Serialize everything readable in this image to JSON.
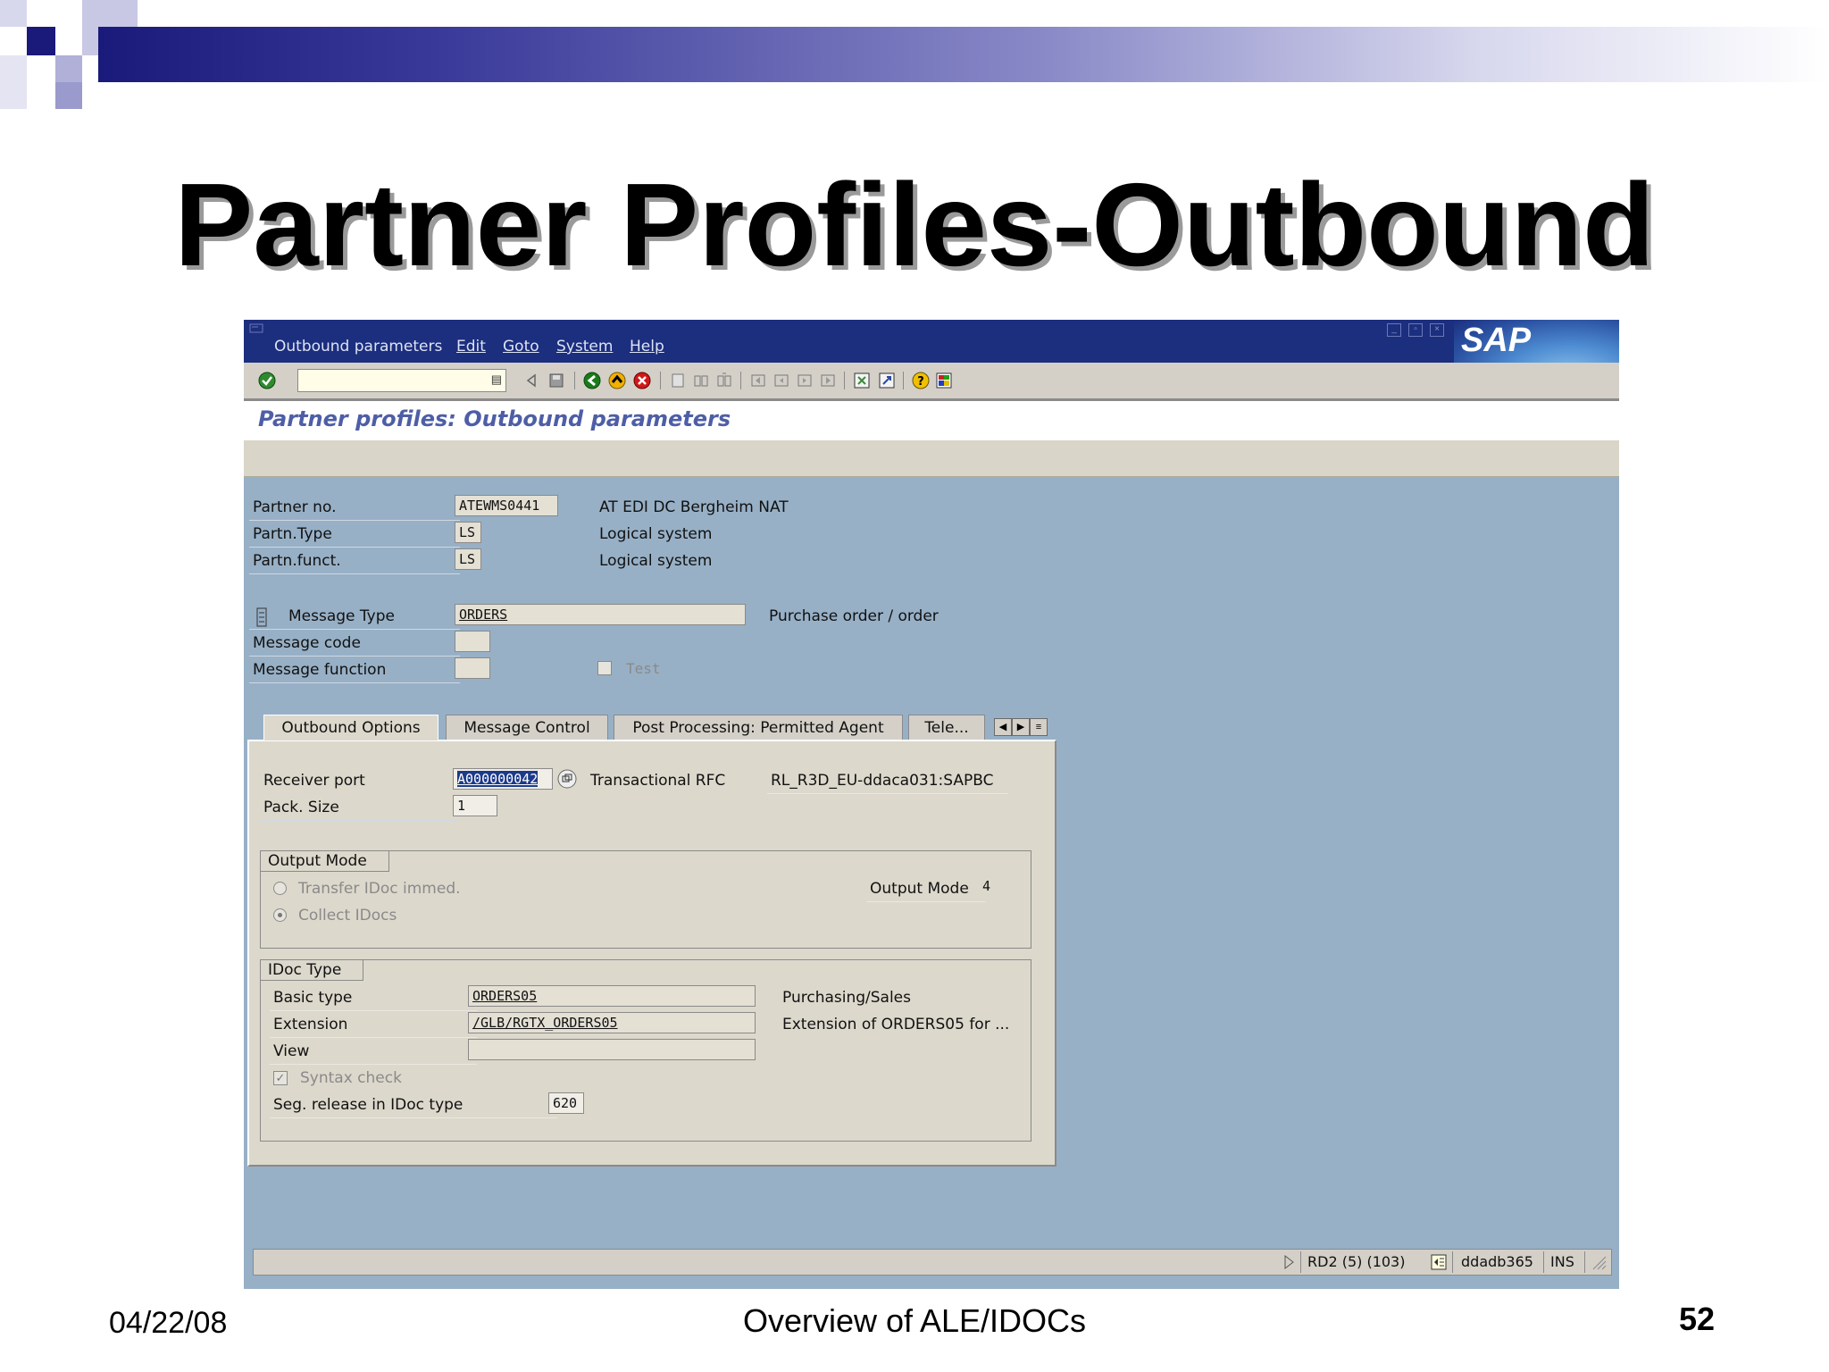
{
  "slide": {
    "title": "Partner Profiles-Outbound",
    "date": "04/22/08",
    "footer_center": "Overview of ALE/IDOCs",
    "page_number": "52"
  },
  "window": {
    "menu": [
      "Outbound parameters",
      "Edit",
      "Goto",
      "System",
      "Help"
    ],
    "logo_text": "SAP",
    "screen_title": "Partner profiles: Outbound parameters",
    "toolbar_icons": [
      "enter-icon",
      "back-arrow-icon",
      "save-icon",
      "back-icon",
      "exit-icon",
      "cancel-icon",
      "print-icon",
      "find-icon",
      "find-next-icon",
      "first-page-icon",
      "previous-page-icon",
      "next-page-icon",
      "last-page-icon",
      "create-session-icon",
      "create-shortcut-icon",
      "help-icon",
      "layout-icon"
    ]
  },
  "header_fields": {
    "partner_no": {
      "label": "Partner no.",
      "value": "ATEWMS0441",
      "desc": "AT EDI DC Bergheim NAT"
    },
    "partn_type": {
      "label": "Partn.Type",
      "value": "LS",
      "desc": "Logical system"
    },
    "partn_funct": {
      "label": "Partn.funct.",
      "value": "LS",
      "desc": "Logical system"
    },
    "message_type": {
      "label": "Message Type",
      "value": "ORDERS",
      "desc": "Purchase order / order"
    },
    "message_code": {
      "label": "Message code",
      "value": ""
    },
    "message_function": {
      "label": "Message function",
      "value": ""
    },
    "test_label": "Test"
  },
  "tabs": [
    "Outbound Options",
    "Message Control",
    "Post Processing: Permitted Agent",
    "Tele..."
  ],
  "outbound_options": {
    "receiver_port": {
      "label": "Receiver port",
      "value": "A000000042",
      "type": "Transactional RFC",
      "desc": "RL_R3D_EU-ddaca031:SAPBC"
    },
    "pack_size": {
      "label": "Pack. Size",
      "value": "1"
    },
    "output_mode": {
      "title": "Output Mode",
      "options": [
        "Transfer IDoc immed.",
        "Collect IDocs"
      ],
      "selected": "Collect IDocs",
      "mode_label": "Output Mode",
      "mode_value": "4"
    },
    "idoc_type": {
      "title": "IDoc Type",
      "basic_type": {
        "label": "Basic type",
        "value": "ORDERS05",
        "desc": "Purchasing/Sales"
      },
      "extension": {
        "label": "Extension",
        "value": "/GLB/RGTX_ORDERS05",
        "desc": "Extension of ORDERS05 for ..."
      },
      "view": {
        "label": "View",
        "value": ""
      },
      "syntax_check": {
        "label": "Syntax check",
        "checked": true
      },
      "seg_release": {
        "label": "Seg. release in IDoc type",
        "value": "620"
      }
    }
  },
  "status_bar": {
    "system": "RD2 (5) (103)",
    "server": "ddadb365",
    "mode": "INS"
  },
  "colors": {
    "title_bar": "#1c2e7e",
    "screen_bg": "#97b0c6",
    "panel_bg": "#dcd8cc"
  }
}
